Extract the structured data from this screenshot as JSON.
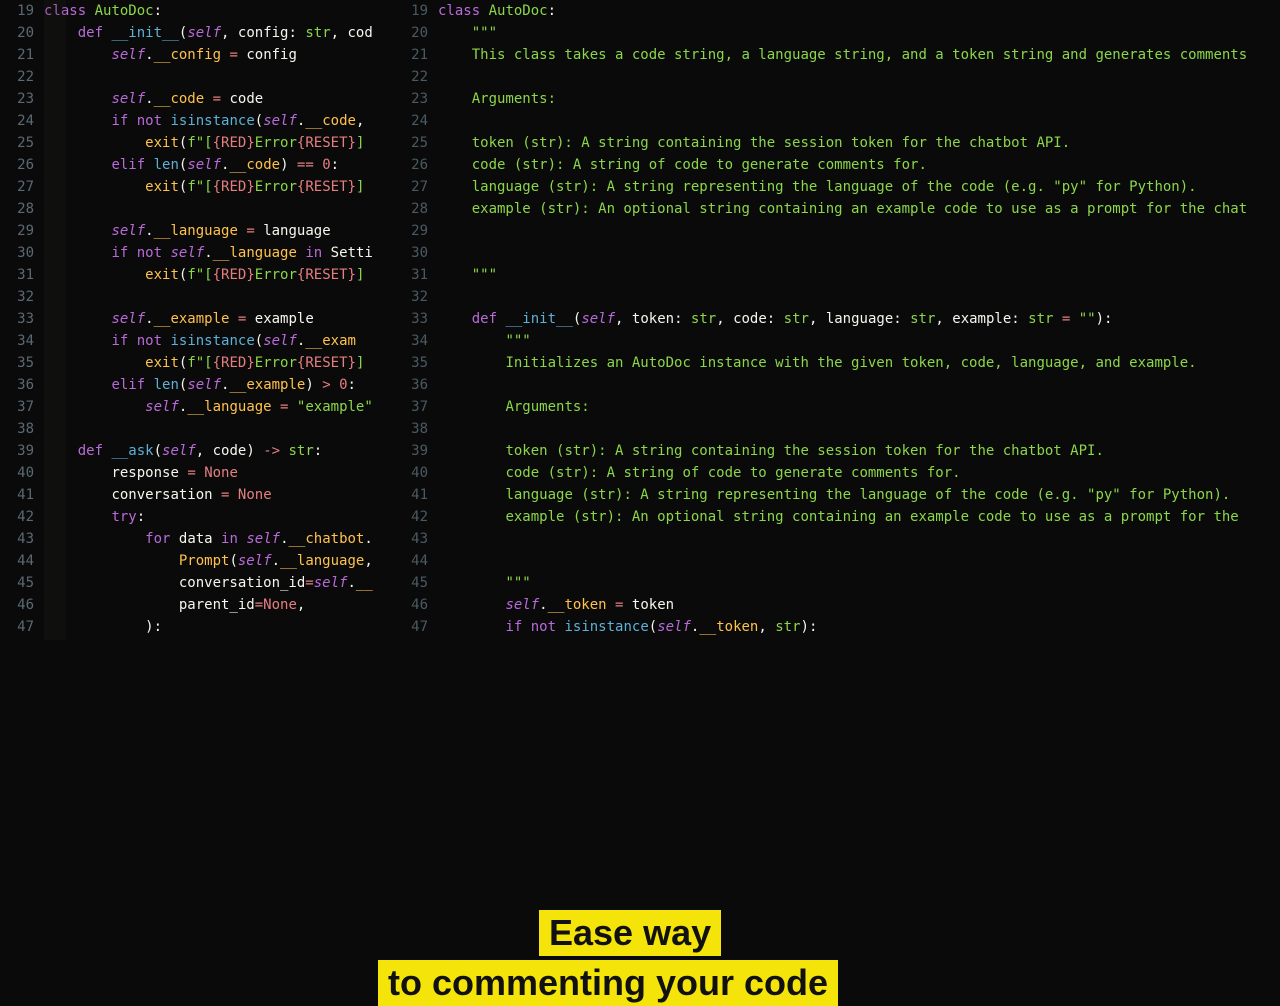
{
  "overlay": {
    "line1": "Ease way",
    "line2": "to commenting your code"
  },
  "left": {
    "start": 19,
    "lines": [
      [
        [
          "kw",
          "class"
        ],
        [
          "punct",
          " "
        ],
        [
          "cls",
          "AutoDoc"
        ],
        [
          "punct",
          ":"
        ]
      ],
      [
        [
          "punct",
          "    "
        ],
        [
          "kw",
          "def"
        ],
        [
          "punct",
          " "
        ],
        [
          "def",
          "__init__"
        ],
        [
          "punct",
          "("
        ],
        [
          "self",
          "self"
        ],
        [
          "punct",
          ", "
        ],
        [
          "id",
          "config"
        ],
        [
          "punct",
          ": "
        ],
        [
          "type",
          "str"
        ],
        [
          "punct",
          ", "
        ],
        [
          "id",
          "cod"
        ]
      ],
      [
        [
          "punct",
          "        "
        ],
        [
          "self",
          "self"
        ],
        [
          "punct",
          "."
        ],
        [
          "attr",
          "__config"
        ],
        [
          "punct",
          " "
        ],
        [
          "op",
          "="
        ],
        [
          "punct",
          " "
        ],
        [
          "id",
          "config"
        ]
      ],
      [],
      [
        [
          "punct",
          "        "
        ],
        [
          "self",
          "self"
        ],
        [
          "punct",
          "."
        ],
        [
          "attr",
          "__code"
        ],
        [
          "punct",
          " "
        ],
        [
          "op",
          "="
        ],
        [
          "punct",
          " "
        ],
        [
          "id",
          "code"
        ]
      ],
      [
        [
          "punct",
          "        "
        ],
        [
          "kw",
          "if"
        ],
        [
          "punct",
          " "
        ],
        [
          "kw",
          "not"
        ],
        [
          "punct",
          " "
        ],
        [
          "builtin",
          "isinstance"
        ],
        [
          "punct",
          "("
        ],
        [
          "self",
          "self"
        ],
        [
          "punct",
          "."
        ],
        [
          "attr",
          "__code"
        ],
        [
          "punct",
          ","
        ]
      ],
      [
        [
          "punct",
          "            "
        ],
        [
          "fn",
          "exit"
        ],
        [
          "punct",
          "("
        ],
        [
          "str",
          "f\"["
        ],
        [
          "interp",
          "{RED}"
        ],
        [
          "str",
          "Error"
        ],
        [
          "interp",
          "{RESET}"
        ],
        [
          "str",
          "]"
        ]
      ],
      [
        [
          "punct",
          "        "
        ],
        [
          "kw",
          "elif"
        ],
        [
          "punct",
          " "
        ],
        [
          "builtin",
          "len"
        ],
        [
          "punct",
          "("
        ],
        [
          "self",
          "self"
        ],
        [
          "punct",
          "."
        ],
        [
          "attr",
          "__code"
        ],
        [
          "punct",
          ") "
        ],
        [
          "op",
          "=="
        ],
        [
          "punct",
          " "
        ],
        [
          "num",
          "0"
        ],
        [
          "punct",
          ":"
        ]
      ],
      [
        [
          "punct",
          "            "
        ],
        [
          "fn",
          "exit"
        ],
        [
          "punct",
          "("
        ],
        [
          "str",
          "f\"["
        ],
        [
          "interp",
          "{RED}"
        ],
        [
          "str",
          "Error"
        ],
        [
          "interp",
          "{RESET}"
        ],
        [
          "str",
          "]"
        ]
      ],
      [],
      [
        [
          "punct",
          "        "
        ],
        [
          "self",
          "self"
        ],
        [
          "punct",
          "."
        ],
        [
          "attr",
          "__language"
        ],
        [
          "punct",
          " "
        ],
        [
          "op",
          "="
        ],
        [
          "punct",
          " "
        ],
        [
          "id",
          "language"
        ]
      ],
      [
        [
          "punct",
          "        "
        ],
        [
          "kw",
          "if"
        ],
        [
          "punct",
          " "
        ],
        [
          "kw",
          "not"
        ],
        [
          "punct",
          " "
        ],
        [
          "self",
          "self"
        ],
        [
          "punct",
          "."
        ],
        [
          "attr",
          "__language"
        ],
        [
          "punct",
          " "
        ],
        [
          "kw",
          "in"
        ],
        [
          "punct",
          " "
        ],
        [
          "id",
          "Setti"
        ]
      ],
      [
        [
          "punct",
          "            "
        ],
        [
          "fn",
          "exit"
        ],
        [
          "punct",
          "("
        ],
        [
          "str",
          "f\"["
        ],
        [
          "interp",
          "{RED}"
        ],
        [
          "str",
          "Error"
        ],
        [
          "interp",
          "{RESET}"
        ],
        [
          "str",
          "]"
        ]
      ],
      [],
      [
        [
          "punct",
          "        "
        ],
        [
          "self",
          "self"
        ],
        [
          "punct",
          "."
        ],
        [
          "attr",
          "__example"
        ],
        [
          "punct",
          " "
        ],
        [
          "op",
          "="
        ],
        [
          "punct",
          " "
        ],
        [
          "id",
          "example"
        ]
      ],
      [
        [
          "punct",
          "        "
        ],
        [
          "kw",
          "if"
        ],
        [
          "punct",
          " "
        ],
        [
          "kw",
          "not"
        ],
        [
          "punct",
          " "
        ],
        [
          "builtin",
          "isinstance"
        ],
        [
          "punct",
          "("
        ],
        [
          "self",
          "self"
        ],
        [
          "punct",
          "."
        ],
        [
          "attr",
          "__exam"
        ]
      ],
      [
        [
          "punct",
          "            "
        ],
        [
          "fn",
          "exit"
        ],
        [
          "punct",
          "("
        ],
        [
          "str",
          "f\"["
        ],
        [
          "interp",
          "{RED}"
        ],
        [
          "str",
          "Error"
        ],
        [
          "interp",
          "{RESET}"
        ],
        [
          "str",
          "]"
        ]
      ],
      [
        [
          "punct",
          "        "
        ],
        [
          "kw",
          "elif"
        ],
        [
          "punct",
          " "
        ],
        [
          "builtin",
          "len"
        ],
        [
          "punct",
          "("
        ],
        [
          "self",
          "self"
        ],
        [
          "punct",
          "."
        ],
        [
          "attr",
          "__example"
        ],
        [
          "punct",
          ") "
        ],
        [
          "op",
          ">"
        ],
        [
          "punct",
          " "
        ],
        [
          "num",
          "0"
        ],
        [
          "punct",
          ":"
        ]
      ],
      [
        [
          "punct",
          "            "
        ],
        [
          "self",
          "self"
        ],
        [
          "punct",
          "."
        ],
        [
          "attr",
          "__language"
        ],
        [
          "punct",
          " "
        ],
        [
          "op",
          "="
        ],
        [
          "punct",
          " "
        ],
        [
          "str",
          "\"example\""
        ]
      ],
      [],
      [
        [
          "punct",
          "    "
        ],
        [
          "kw",
          "def"
        ],
        [
          "punct",
          " "
        ],
        [
          "def",
          "__ask"
        ],
        [
          "punct",
          "("
        ],
        [
          "self",
          "self"
        ],
        [
          "punct",
          ", "
        ],
        [
          "id",
          "code"
        ],
        [
          "punct",
          ") "
        ],
        [
          "op",
          "->"
        ],
        [
          "punct",
          " "
        ],
        [
          "type",
          "str"
        ],
        [
          "punct",
          ":"
        ]
      ],
      [
        [
          "punct",
          "        "
        ],
        [
          "id",
          "response"
        ],
        [
          "punct",
          " "
        ],
        [
          "op",
          "="
        ],
        [
          "punct",
          " "
        ],
        [
          "none",
          "None"
        ]
      ],
      [
        [
          "punct",
          "        "
        ],
        [
          "id",
          "conversation"
        ],
        [
          "punct",
          " "
        ],
        [
          "op",
          "="
        ],
        [
          "punct",
          " "
        ],
        [
          "none",
          "None"
        ]
      ],
      [
        [
          "punct",
          "        "
        ],
        [
          "kw",
          "try"
        ],
        [
          "punct",
          ":"
        ]
      ],
      [
        [
          "punct",
          "            "
        ],
        [
          "kw",
          "for"
        ],
        [
          "punct",
          " "
        ],
        [
          "id",
          "data"
        ],
        [
          "punct",
          " "
        ],
        [
          "kw",
          "in"
        ],
        [
          "punct",
          " "
        ],
        [
          "self",
          "self"
        ],
        [
          "punct",
          "."
        ],
        [
          "attr",
          "__chatbot"
        ],
        [
          "punct",
          "."
        ]
      ],
      [
        [
          "punct",
          "                "
        ],
        [
          "fn",
          "Prompt"
        ],
        [
          "punct",
          "("
        ],
        [
          "self",
          "self"
        ],
        [
          "punct",
          "."
        ],
        [
          "attr",
          "__language"
        ],
        [
          "punct",
          ","
        ]
      ],
      [
        [
          "punct",
          "                "
        ],
        [
          "id",
          "conversation_id"
        ],
        [
          "op",
          "="
        ],
        [
          "self",
          "self"
        ],
        [
          "punct",
          "."
        ],
        [
          "attr",
          "__"
        ]
      ],
      [
        [
          "punct",
          "                "
        ],
        [
          "id",
          "parent_id"
        ],
        [
          "op",
          "="
        ],
        [
          "none",
          "None"
        ],
        [
          "punct",
          ","
        ]
      ],
      [
        [
          "punct",
          "            "
        ],
        [
          "punct",
          ")"
        ],
        [
          "punct",
          ":"
        ]
      ]
    ]
  },
  "right": {
    "start": 19,
    "lines": [
      [
        [
          "kw",
          "class"
        ],
        [
          "punct",
          " "
        ],
        [
          "cls",
          "AutoDoc"
        ],
        [
          "punct",
          ":"
        ]
      ],
      [
        [
          "punct",
          "    "
        ],
        [
          "cm",
          "\"\"\""
        ]
      ],
      [
        [
          "punct",
          "    "
        ],
        [
          "cm",
          "This class takes a code string, a language string, and a token string and generates comments"
        ]
      ],
      [],
      [
        [
          "punct",
          "    "
        ],
        [
          "cm",
          "Arguments:"
        ]
      ],
      [],
      [
        [
          "punct",
          "    "
        ],
        [
          "cm",
          "token (str): A string containing the session token for the chatbot API."
        ]
      ],
      [
        [
          "punct",
          "    "
        ],
        [
          "cm",
          "code (str): A string of code to generate comments for."
        ]
      ],
      [
        [
          "punct",
          "    "
        ],
        [
          "cm",
          "language (str): A string representing the language of the code (e.g. \"py\" for Python)."
        ]
      ],
      [
        [
          "punct",
          "    "
        ],
        [
          "cm",
          "example (str): An optional string containing an example code to use as a prompt for the chat"
        ]
      ],
      [],
      [],
      [
        [
          "punct",
          "    "
        ],
        [
          "cm",
          "\"\"\""
        ]
      ],
      [],
      [
        [
          "punct",
          "    "
        ],
        [
          "kw",
          "def"
        ],
        [
          "punct",
          " "
        ],
        [
          "def",
          "__init__"
        ],
        [
          "punct",
          "("
        ],
        [
          "self",
          "self"
        ],
        [
          "punct",
          ", "
        ],
        [
          "id",
          "token"
        ],
        [
          "punct",
          ": "
        ],
        [
          "type",
          "str"
        ],
        [
          "punct",
          ", "
        ],
        [
          "id",
          "code"
        ],
        [
          "punct",
          ": "
        ],
        [
          "type",
          "str"
        ],
        [
          "punct",
          ", "
        ],
        [
          "id",
          "language"
        ],
        [
          "punct",
          ": "
        ],
        [
          "type",
          "str"
        ],
        [
          "punct",
          ", "
        ],
        [
          "id",
          "example"
        ],
        [
          "punct",
          ": "
        ],
        [
          "type",
          "str"
        ],
        [
          "punct",
          " "
        ],
        [
          "op",
          "="
        ],
        [
          "punct",
          " "
        ],
        [
          "str",
          "\"\""
        ],
        [
          "punct",
          "):"
        ]
      ],
      [
        [
          "punct",
          "        "
        ],
        [
          "cm",
          "\"\"\""
        ]
      ],
      [
        [
          "punct",
          "        "
        ],
        [
          "cm",
          "Initializes an AutoDoc instance with the given token, code, language, and example."
        ]
      ],
      [],
      [
        [
          "punct",
          "        "
        ],
        [
          "cm",
          "Arguments:"
        ]
      ],
      [],
      [
        [
          "punct",
          "        "
        ],
        [
          "cm",
          "token (str): A string containing the session token for the chatbot API."
        ]
      ],
      [
        [
          "punct",
          "        "
        ],
        [
          "cm",
          "code (str): A string of code to generate comments for."
        ]
      ],
      [
        [
          "punct",
          "        "
        ],
        [
          "cm",
          "language (str): A string representing the language of the code (e.g. \"py\" for Python)."
        ]
      ],
      [
        [
          "punct",
          "        "
        ],
        [
          "cm",
          "example (str): An optional string containing an example code to use as a prompt for the"
        ]
      ],
      [],
      [],
      [
        [
          "punct",
          "        "
        ],
        [
          "cm",
          "\"\"\""
        ]
      ],
      [
        [
          "punct",
          "        "
        ],
        [
          "self",
          "self"
        ],
        [
          "punct",
          "."
        ],
        [
          "attr",
          "__token"
        ],
        [
          "punct",
          " "
        ],
        [
          "op",
          "="
        ],
        [
          "punct",
          " "
        ],
        [
          "id",
          "token"
        ]
      ],
      [
        [
          "punct",
          "        "
        ],
        [
          "kw",
          "if"
        ],
        [
          "punct",
          " "
        ],
        [
          "kw",
          "not"
        ],
        [
          "punct",
          " "
        ],
        [
          "builtin",
          "isinstance"
        ],
        [
          "punct",
          "("
        ],
        [
          "self",
          "self"
        ],
        [
          "punct",
          "."
        ],
        [
          "attr",
          "__token"
        ],
        [
          "punct",
          ", "
        ],
        [
          "type",
          "str"
        ],
        [
          "punct",
          "):"
        ]
      ]
    ]
  }
}
